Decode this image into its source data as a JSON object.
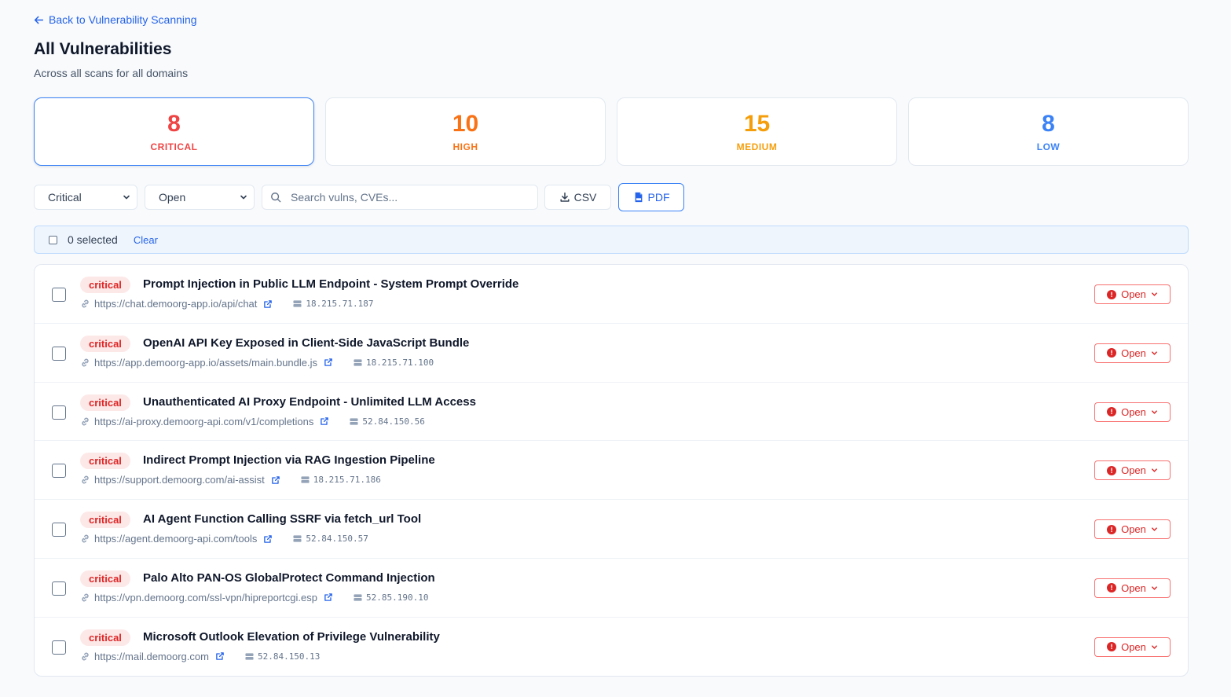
{
  "nav": {
    "back_label": "Back to Vulnerability Scanning"
  },
  "header": {
    "title": "All Vulnerabilities",
    "subtitle": "Across all scans for all domains"
  },
  "stats": [
    {
      "count": "8",
      "label": "CRITICAL",
      "color": "#ef4444"
    },
    {
      "count": "10",
      "label": "HIGH",
      "color": "#f97316"
    },
    {
      "count": "15",
      "label": "MEDIUM",
      "color": "#f59e0b"
    },
    {
      "count": "8",
      "label": "LOW",
      "color": "#3b82f6"
    }
  ],
  "filters": {
    "severity_value": "Critical",
    "status_value": "Open",
    "search_placeholder": "Search vulns, CVEs...",
    "csv_label": "CSV",
    "pdf_label": "PDF"
  },
  "selection": {
    "count_label": "0 selected",
    "clear_label": "Clear"
  },
  "vulnerabilities": [
    {
      "severity": "critical",
      "title": "Prompt Injection in Public LLM Endpoint - System Prompt Override",
      "url": "https://chat.demoorg-app.io/api/chat",
      "ip": "18.215.71.187",
      "status": "Open"
    },
    {
      "severity": "critical",
      "title": "OpenAI API Key Exposed in Client-Side JavaScript Bundle",
      "url": "https://app.demoorg-app.io/assets/main.bundle.js",
      "ip": "18.215.71.100",
      "status": "Open"
    },
    {
      "severity": "critical",
      "title": "Unauthenticated AI Proxy Endpoint - Unlimited LLM Access",
      "url": "https://ai-proxy.demoorg-api.com/v1/completions",
      "ip": "52.84.150.56",
      "status": "Open"
    },
    {
      "severity": "critical",
      "title": "Indirect Prompt Injection via RAG Ingestion Pipeline",
      "url": "https://support.demoorg.com/ai-assist",
      "ip": "18.215.71.186",
      "status": "Open"
    },
    {
      "severity": "critical",
      "title": "AI Agent Function Calling SSRF via fetch_url Tool",
      "url": "https://agent.demoorg-api.com/tools",
      "ip": "52.84.150.57",
      "status": "Open"
    },
    {
      "severity": "critical",
      "title": "Palo Alto PAN-OS GlobalProtect Command Injection",
      "url": "https://vpn.demoorg.com/ssl-vpn/hipreportcgi.esp",
      "ip": "52.85.190.10",
      "status": "Open"
    },
    {
      "severity": "critical",
      "title": "Microsoft Outlook Elevation of Privilege Vulnerability",
      "url": "https://mail.demoorg.com",
      "ip": "52.84.150.13",
      "status": "Open"
    }
  ],
  "colors": {
    "accent": "#2563eb",
    "critical": "#dc2626",
    "critical_bg": "#fde8e8"
  }
}
